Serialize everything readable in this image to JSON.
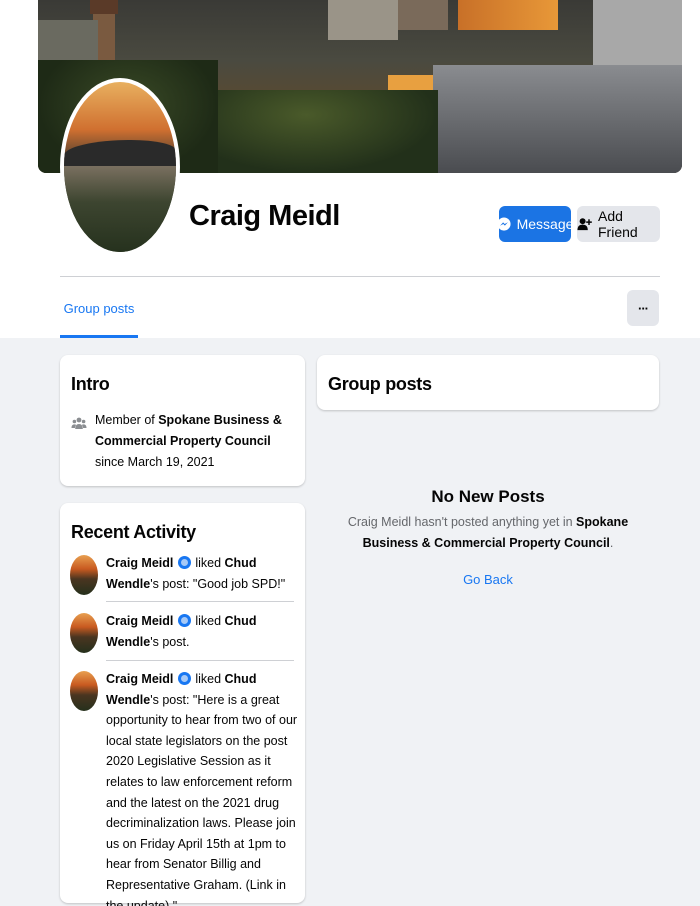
{
  "profile": {
    "name": "Craig Meidl"
  },
  "actions": {
    "message_label": "Message",
    "add_friend_label": "Add Friend",
    "more_label": "···"
  },
  "tabs": {
    "active": "Group posts"
  },
  "intro": {
    "title": "Intro",
    "prefix": "Member of ",
    "group": "Spokane Business & Commercial Property Council",
    "suffix": " since March 19, 2021"
  },
  "recent_activity": {
    "title": "Recent Activity",
    "items": [
      {
        "actor": "Craig Meidl",
        "verb": " liked ",
        "target": "Chud Wendle",
        "text": "'s post: \"Good job SPD!\""
      },
      {
        "actor": "Craig Meidl",
        "verb": " liked ",
        "target": "Chud Wendle",
        "text": "'s post."
      },
      {
        "actor": "Craig Meidl",
        "verb": " liked ",
        "target": "Chud Wendle",
        "text": "'s post: \"Here is a great opportunity to hear from two of our local state legislators on the post 2020 Legislative Session as it relates to law enforcement reform and the latest on the 2021 drug decriminalization laws. Please join us on Friday April 15th at 1pm to hear from Senator Billig and Representative Graham. (Link in the update).\""
      }
    ]
  },
  "group_posts": {
    "title": "Group posts",
    "empty_title": "No New Posts",
    "empty_prefix": "Craig Meidl hasn't posted anything yet in ",
    "empty_group": "Spokane Business & Commercial Property Council",
    "empty_suffix": ".",
    "go_back_label": "Go Back"
  },
  "colors": {
    "accent": "#1877f2",
    "message_button": "#1b74e4",
    "page_bg": "#f0f2f5"
  }
}
